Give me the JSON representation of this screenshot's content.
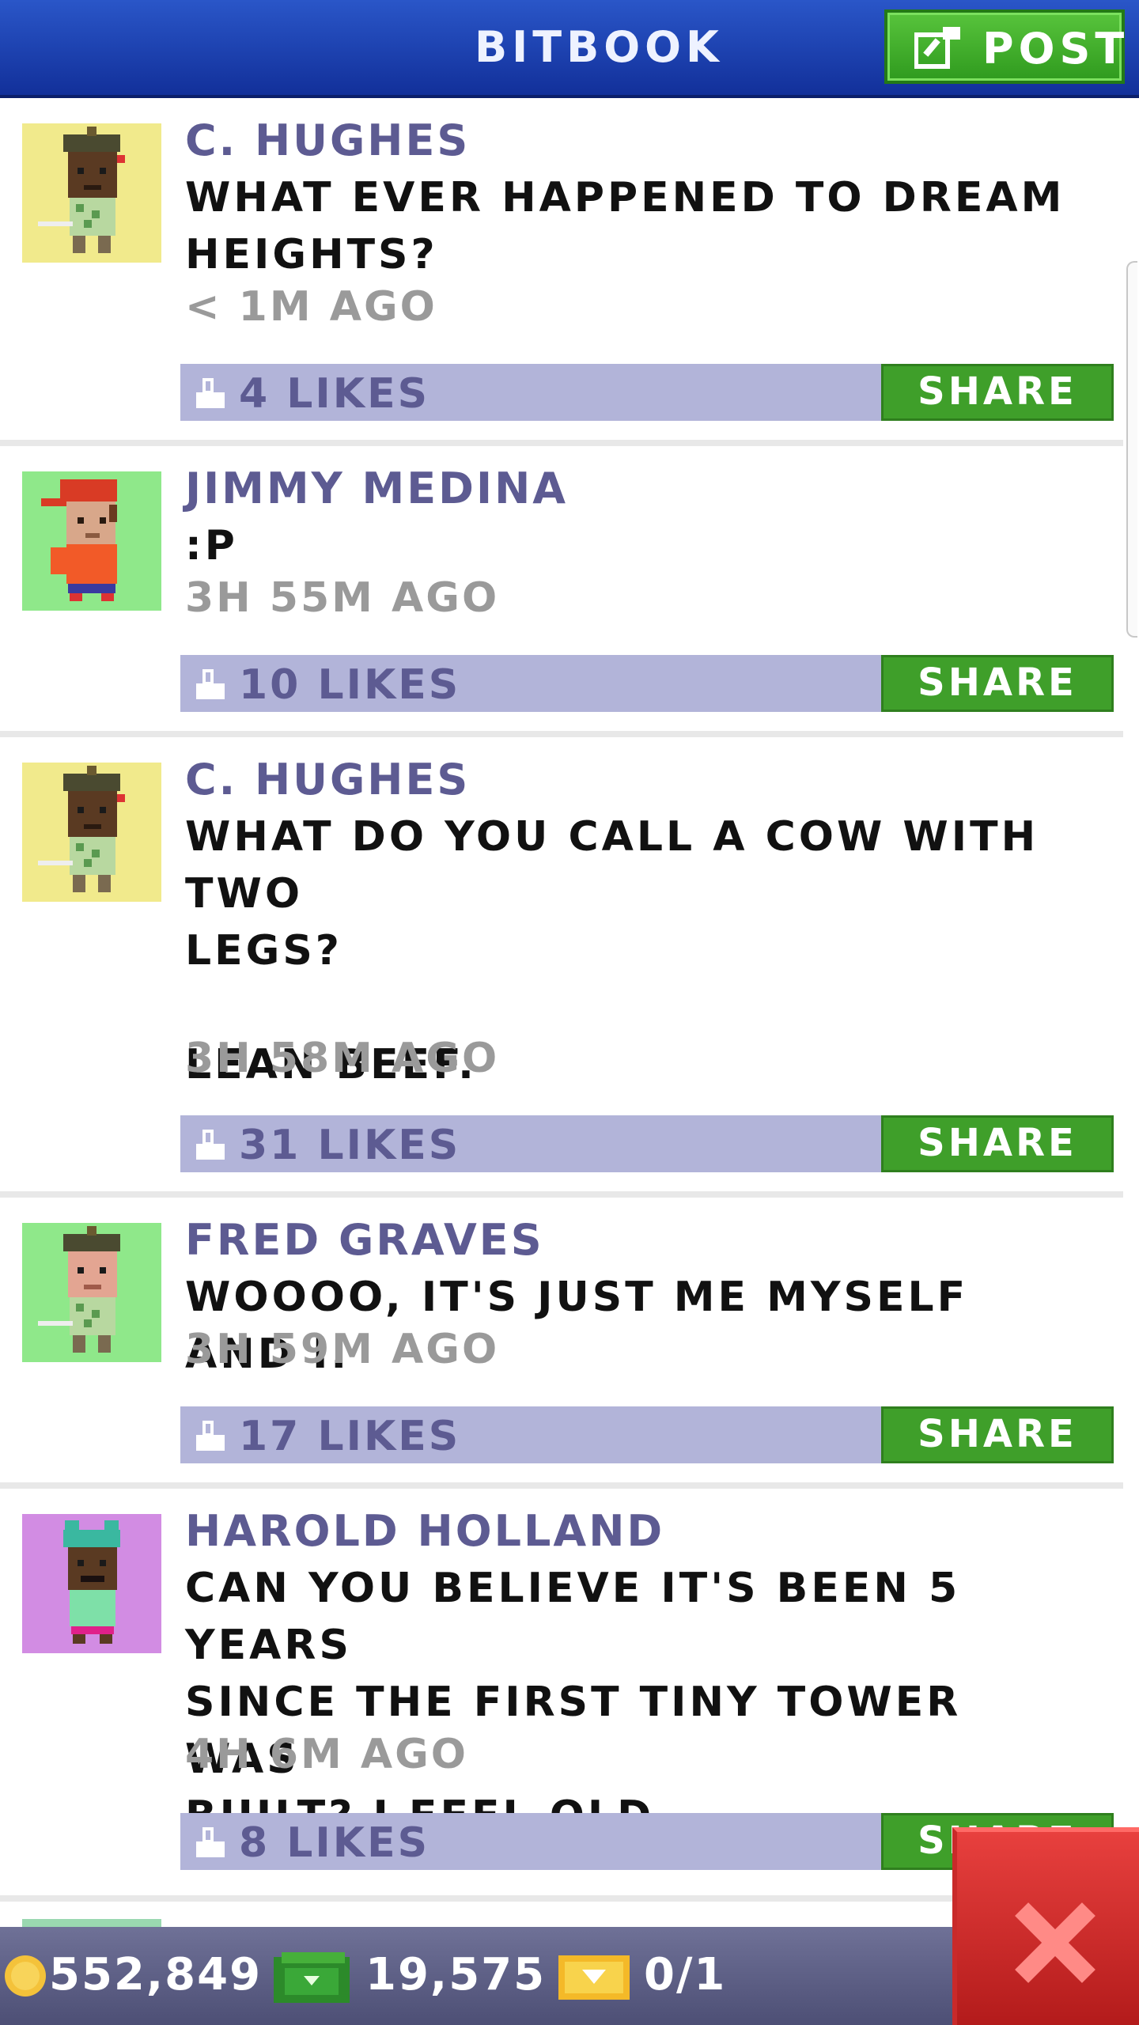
{
  "header": {
    "title": "BITBOOK",
    "post_label": "POST"
  },
  "posts": [
    {
      "name": "C. HUGHES",
      "message": "WHAT EVER HAPPENED TO DREAM\nHEIGHTS?",
      "time": "< 1M AGO",
      "likes": "4 LIKES",
      "share": "SHARE",
      "avatar": "avatar-golfer-dark"
    },
    {
      "name": "JIMMY MEDINA",
      "message": ":P",
      "time": "3H 55M AGO",
      "likes": "10 LIKES",
      "share": "SHARE",
      "avatar": "avatar-red-cap"
    },
    {
      "name": "C. HUGHES",
      "message": "WHAT DO YOU CALL A COW WITH TWO\nLEGS?\n\nLEAN BEEF.",
      "time": "3H 58M AGO",
      "likes": "31 LIKES",
      "share": "SHARE",
      "avatar": "avatar-golfer-dark"
    },
    {
      "name": "FRED GRAVES",
      "message": "WOOOO, IT'S JUST ME MYSELF AND I.",
      "time": "3H 59M AGO",
      "likes": "17 LIKES",
      "share": "SHARE",
      "avatar": "avatar-golfer-light"
    },
    {
      "name": "HAROLD HOLLAND",
      "message": "CAN YOU BELIEVE IT'S BEEN 5 YEARS\nSINCE THE FIRST TINY TOWER WAS\nBUILT? I FEEL OLD.",
      "time": "4H 6M AGO",
      "likes": "8 LIKES",
      "share": "SHARE",
      "avatar": "avatar-frog-hat"
    }
  ],
  "bottom": {
    "coins": "552,849",
    "bux": "19,575",
    "tickets": "0/1"
  },
  "colors": {
    "header": "#1f44b8",
    "like_bar": "#b2b4d9",
    "share": "#3f9f2a",
    "name": "#5d5b92",
    "close": "#d83232"
  },
  "icons": [
    "edit-icon",
    "thumbs-up-icon",
    "coin-icon",
    "bux-icon",
    "ticket-icon",
    "close-icon"
  ]
}
